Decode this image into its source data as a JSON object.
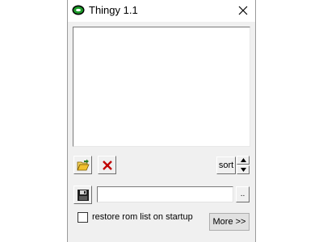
{
  "window": {
    "title": "Thingy 1.1"
  },
  "icons": {
    "app": "app-icon",
    "close": "close-icon",
    "open": "open-folder-icon",
    "remove": "delete-icon",
    "save": "save-disk-icon",
    "up": "arrow-up-icon",
    "down": "arrow-down-icon"
  },
  "rom_list": {
    "items": []
  },
  "controls": {
    "sort_label": "sort",
    "path_value": "",
    "browse_label": "..",
    "restore_label": "restore rom list on startup",
    "restore_checked": false,
    "more_label": "More >>"
  },
  "colors": {
    "window_bg": "#f0f0f0",
    "remove_red": "#c00000",
    "app_icon_green": "#1e9b2b"
  }
}
